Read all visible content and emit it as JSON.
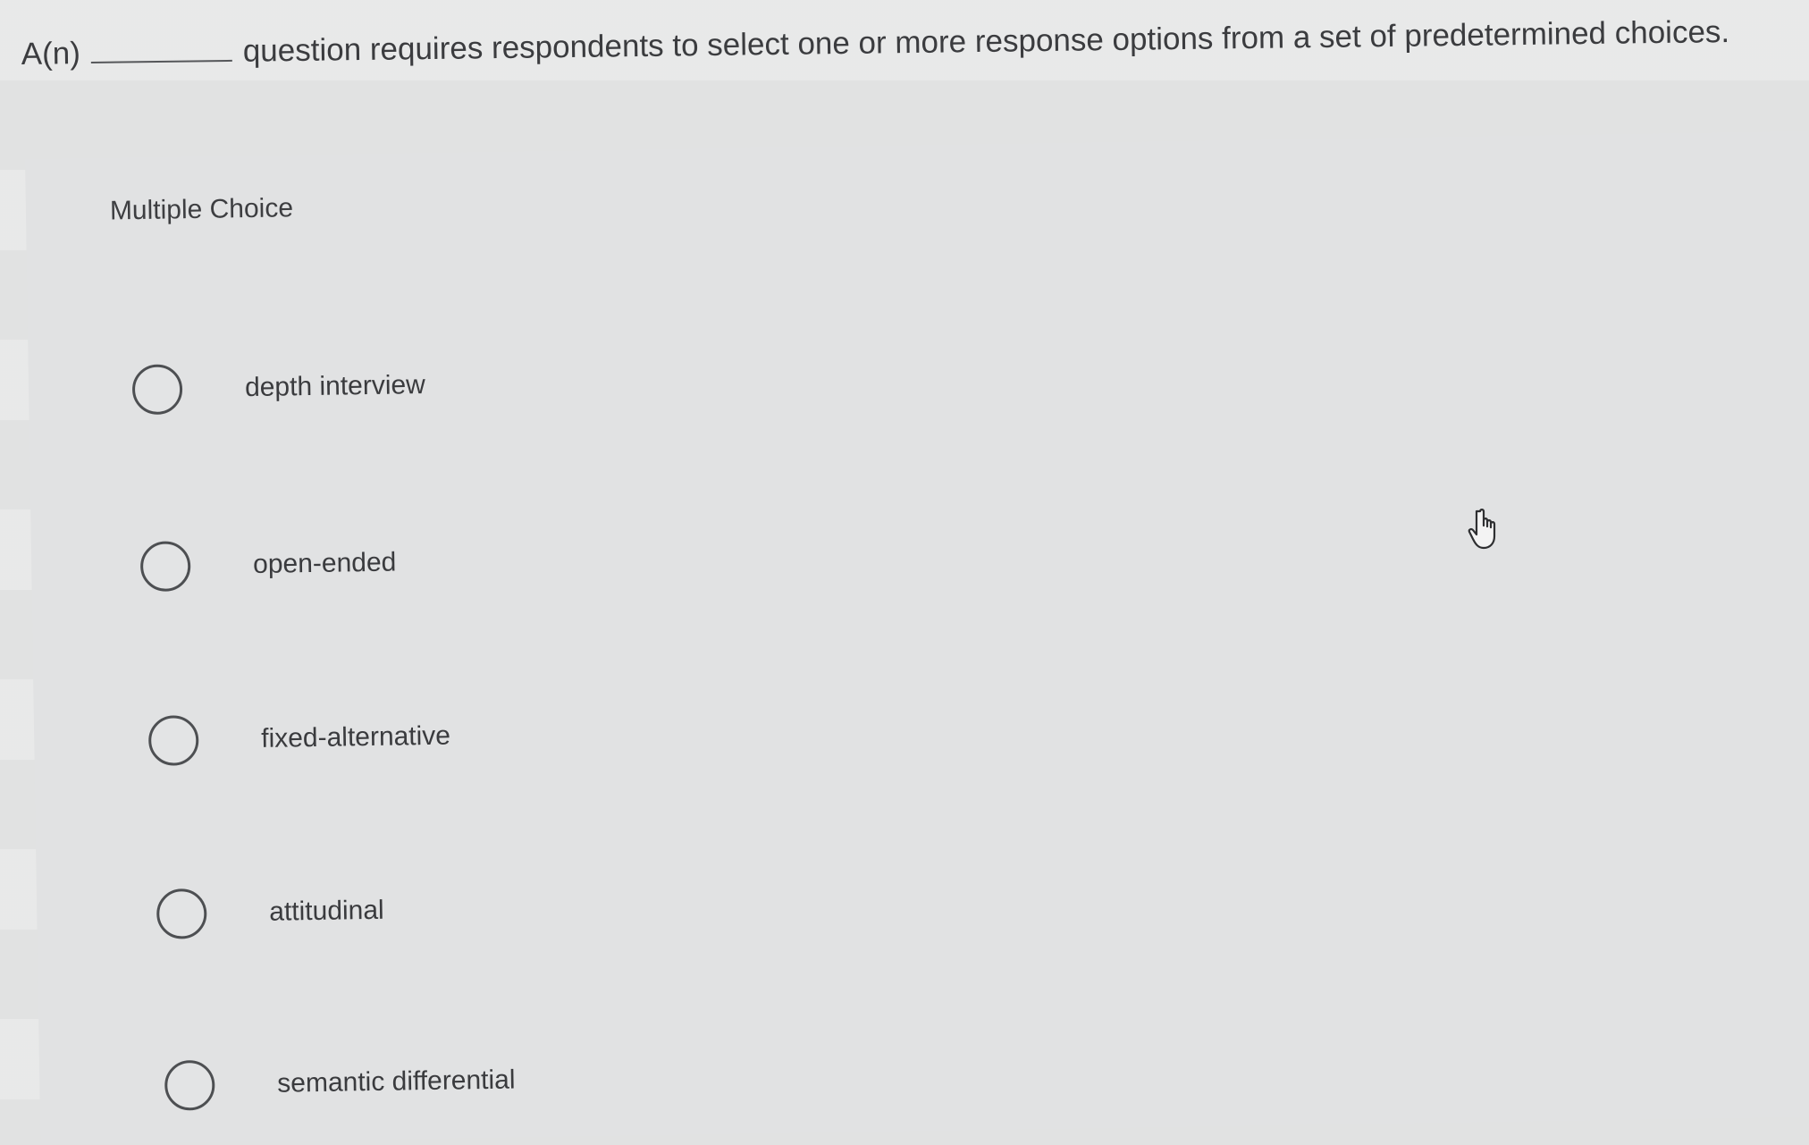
{
  "question": {
    "prefix": "A(n)",
    "suffix": "question requires respondents to select one or more response options from a set of predetermined choices."
  },
  "panel": {
    "label": "Multiple Choice"
  },
  "options": [
    {
      "label": "depth interview",
      "selected": false
    },
    {
      "label": "open-ended",
      "selected": false
    },
    {
      "label": "fixed-alternative",
      "selected": false
    },
    {
      "label": "attitudinal",
      "selected": false
    },
    {
      "label": "semantic differential",
      "selected": false
    }
  ],
  "cursor": {
    "icon": "hand-pointer-icon"
  }
}
